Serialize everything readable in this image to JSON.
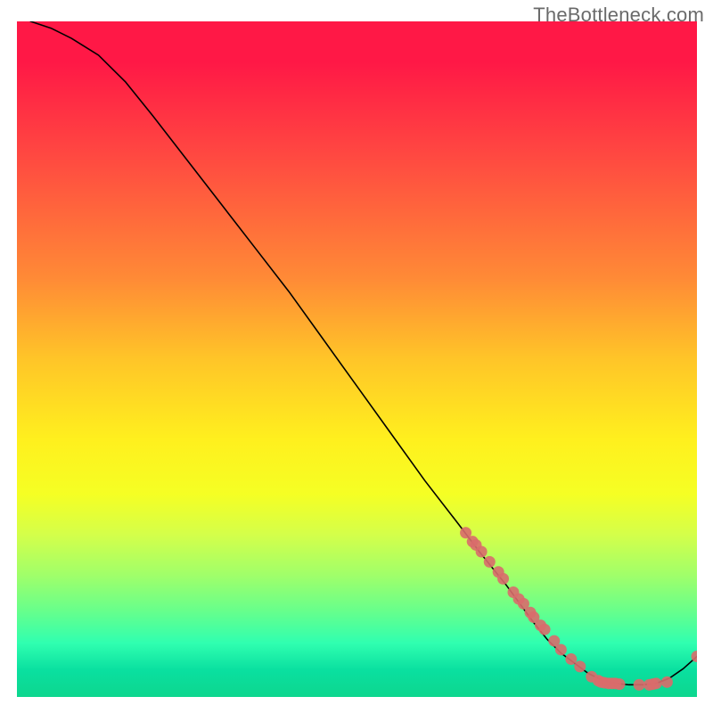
{
  "watermark": "TheBottleneck.com",
  "chart_data": {
    "type": "line",
    "title": "",
    "xlabel": "",
    "ylabel": "",
    "xlim": [
      0,
      100
    ],
    "ylim": [
      0,
      100
    ],
    "series": [
      {
        "name": "curve",
        "style": "line",
        "color": "#000000",
        "x": [
          2,
          5,
          8,
          12,
          16,
          20,
          25,
          30,
          35,
          40,
          45,
          50,
          55,
          60,
          65,
          68,
          72,
          76,
          78,
          80,
          82,
          84,
          86,
          88,
          90,
          92,
          94,
          96,
          98,
          100
        ],
        "y": [
          100,
          99,
          97.5,
          95,
          91,
          86,
          79.5,
          73,
          66.5,
          60,
          53,
          46,
          39,
          32,
          25.5,
          21.5,
          16.5,
          11,
          8.5,
          6.5,
          5,
          3.5,
          2.5,
          2,
          1.8,
          1.8,
          2,
          2.8,
          4.2,
          6
        ]
      },
      {
        "name": "markers",
        "style": "scatter",
        "color": "#d96b6b",
        "x": [
          66,
          67,
          67.5,
          68.3,
          69.5,
          70.8,
          71.5,
          73,
          73.8,
          74.5,
          75.5,
          76,
          77,
          77.6,
          79,
          80,
          81.5,
          82.8,
          84.5,
          85.5,
          85.9,
          86.4,
          87,
          87.5,
          88,
          88.6,
          91.5,
          93,
          93.5,
          94,
          95.6,
          100
        ],
        "y": [
          24.3,
          23,
          22.5,
          21.5,
          20,
          18.5,
          17.5,
          15.5,
          14.5,
          13.8,
          12.5,
          11.8,
          10.6,
          10,
          8.3,
          7,
          5.6,
          4.5,
          3,
          2.4,
          2.2,
          2.1,
          2,
          2,
          2,
          1.9,
          1.8,
          1.8,
          1.9,
          2,
          2.2,
          6
        ]
      }
    ]
  }
}
